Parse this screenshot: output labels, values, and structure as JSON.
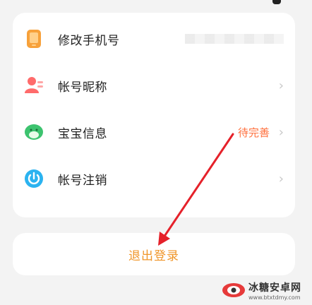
{
  "settings": {
    "items": [
      {
        "label": "修改手机号",
        "icon": "phone-icon",
        "trailing": "masked-value"
      },
      {
        "label": "帐号昵称",
        "icon": "user-card-icon",
        "trailing": "chevron"
      },
      {
        "label": "宝宝信息",
        "icon": "baby-face-icon",
        "trailing": "status",
        "status": "待完善"
      },
      {
        "label": "帐号注销",
        "icon": "power-icon",
        "trailing": "chevron"
      }
    ],
    "chevron": "›"
  },
  "logout": {
    "label": "退出登录"
  },
  "watermark": {
    "title": "冰糖安卓网",
    "subtitle": "www.btxtdmy.com"
  },
  "colors": {
    "accent": "#f0962a",
    "status": "#ff6f3c",
    "arrow": "#e5212a",
    "top_bar": "#f79420"
  }
}
